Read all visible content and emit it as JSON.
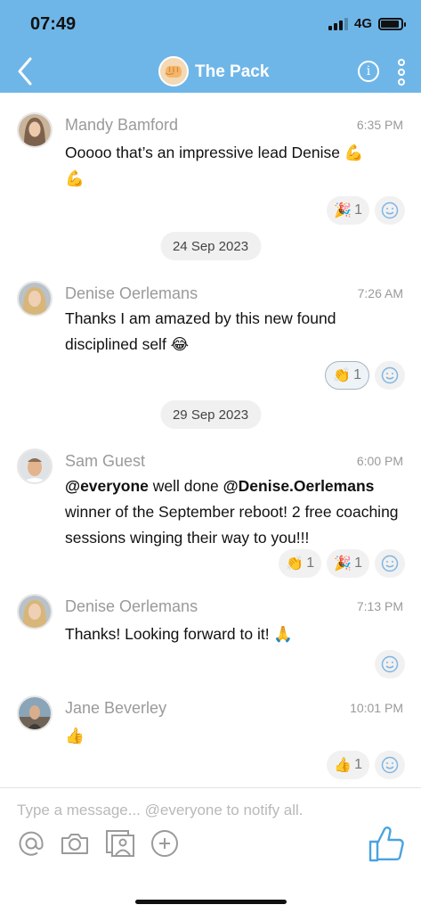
{
  "status_bar": {
    "time": "07:49",
    "network": "4G",
    "battery_level": 0.9
  },
  "header": {
    "title": "The Pack",
    "back_icon": "chevron-left-icon",
    "group_avatar_icon": "fist-icon",
    "info_icon": "info-icon",
    "more_icon": "more-vertical-icon",
    "accent_color": "#6fb6e8"
  },
  "messages": [
    {
      "sender": "Mandy Bamford",
      "time": "6:35 PM",
      "text": "Ooooo that’s an impressive lead Denise ",
      "text_emojis": [
        "💪",
        "💪"
      ],
      "reactions": [
        {
          "emoji": "🎉",
          "count": "1",
          "active": false
        }
      ]
    },
    {
      "sender": "Denise Oerlemans",
      "time": "7:26 AM",
      "text_line1": "Thanks I am amazed by this new found",
      "text_line2": "disciplined self ",
      "text_emoji": "😂",
      "reactions": [
        {
          "emoji": "👏",
          "count": "1",
          "active": true
        }
      ]
    },
    {
      "sender": "Sam Guest",
      "time": "6:00 PM",
      "mention1": "@everyone",
      "text_part1": " well done ",
      "mention2": "@Denise.Oerlemans",
      "text_part2": "winner of the September reboot! 2 free coaching sessions winging their way to you!!!",
      "reactions": [
        {
          "emoji": "👏",
          "count": "1",
          "active": false
        },
        {
          "emoji": "🎉",
          "count": "1",
          "active": false
        }
      ]
    },
    {
      "sender": "Denise Oerlemans",
      "time": "7:13 PM",
      "text": "Thanks! Looking forward to it! ",
      "text_emoji": "🙏"
    },
    {
      "sender": "Jane Beverley",
      "time": "10:01 PM",
      "text_emoji": "👍",
      "reactions": [
        {
          "emoji": "👍",
          "count": "1",
          "active": false
        }
      ]
    }
  ],
  "date_separators": [
    "24 Sep 2023",
    "29 Sep 2023"
  ],
  "composer": {
    "placeholder": "Type a message... @everyone to notify all.",
    "tools": [
      "at-sign-icon",
      "camera-icon",
      "gallery-icon",
      "plus-circle-icon"
    ],
    "send_icon": "thumbs-up-icon"
  }
}
